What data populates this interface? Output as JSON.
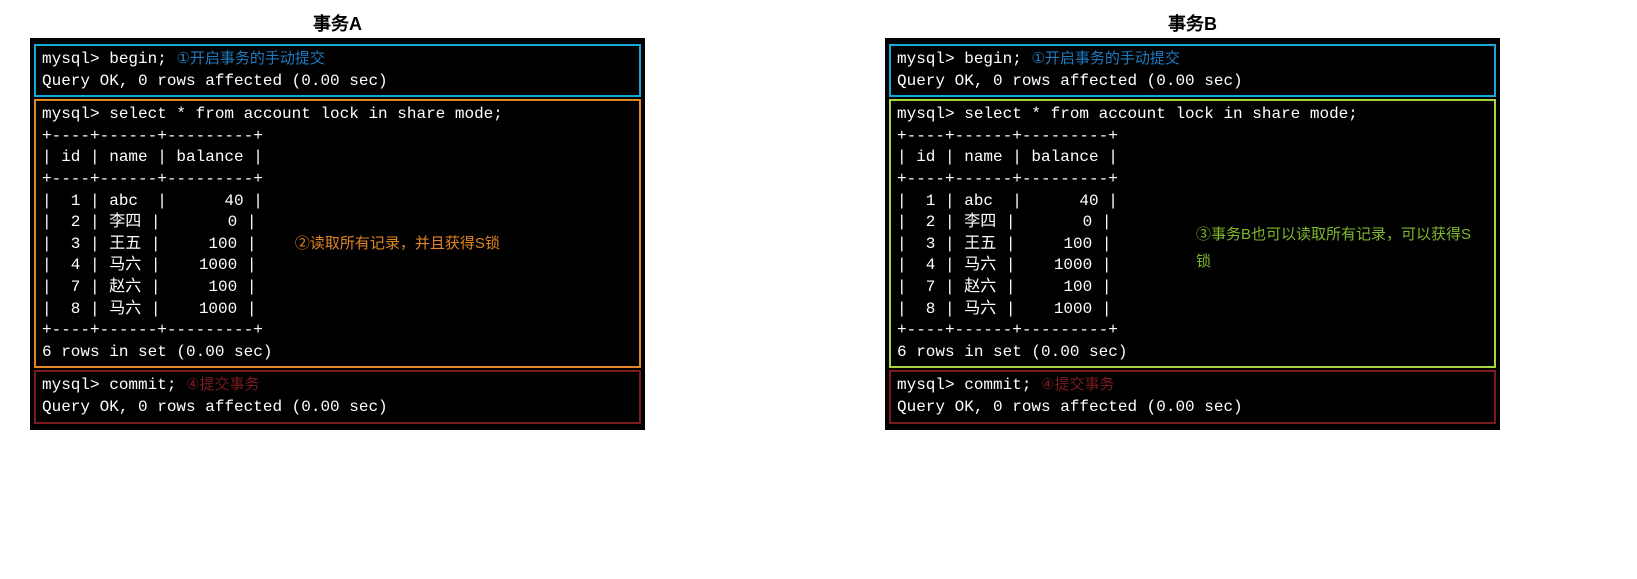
{
  "panels": {
    "A": {
      "title": "事务A",
      "begin": {
        "cmd": "mysql> begin;",
        "note": "①开启事务的手动提交",
        "result": "Query OK, 0 rows affected (0.00 sec)"
      },
      "select": {
        "cmd": "mysql> select * from account lock in share mode;",
        "sep": "+----+------+---------+",
        "head": "| id | name | balance |",
        "rows": [
          "|  1 | abc  |      40 |",
          "|  2 | 李四 |       0 |",
          "|  3 | 王五 |     100 |",
          "|  4 | 马六 |    1000 |",
          "|  7 | 赵六 |     100 |",
          "|  8 | 马六 |    1000 |"
        ],
        "footer": "6 rows in set (0.00 sec)",
        "note": "②读取所有记录，并且获得S锁"
      },
      "commit": {
        "cmd": "mysql> commit;",
        "note": "④提交事务",
        "result": "Query OK, 0 rows affected (0.00 sec)"
      }
    },
    "B": {
      "title": "事务B",
      "begin": {
        "cmd": "mysql> begin;",
        "note": "①开启事务的手动提交",
        "result": "Query OK, 0 rows affected (0.00 sec)"
      },
      "select": {
        "cmd": "mysql> select * from account lock in share mode;",
        "sep": "+----+------+---------+",
        "head": "| id | name | balance |",
        "rows": [
          "|  1 | abc  |      40 |",
          "|  2 | 李四 |       0 |",
          "|  3 | 王五 |     100 |",
          "|  4 | 马六 |    1000 |",
          "|  7 | 赵六 |     100 |",
          "|  8 | 马六 |    1000 |"
        ],
        "footer": "6 rows in set (0.00 sec)",
        "note": "③事务B也可以读取所有记录，可以获得S锁"
      },
      "commit": {
        "cmd": "mysql> commit;",
        "note": "④提交事务",
        "result": "Query OK, 0 rows affected (0.00 sec)"
      }
    }
  },
  "chart_data": {
    "type": "table",
    "title": "account (lock in share mode)",
    "columns": [
      "id",
      "name",
      "balance"
    ],
    "rows": [
      [
        1,
        "abc",
        40
      ],
      [
        2,
        "李四",
        0
      ],
      [
        3,
        "王五",
        100
      ],
      [
        4,
        "马六",
        1000
      ],
      [
        7,
        "赵六",
        100
      ],
      [
        8,
        "马六",
        1000
      ]
    ]
  }
}
